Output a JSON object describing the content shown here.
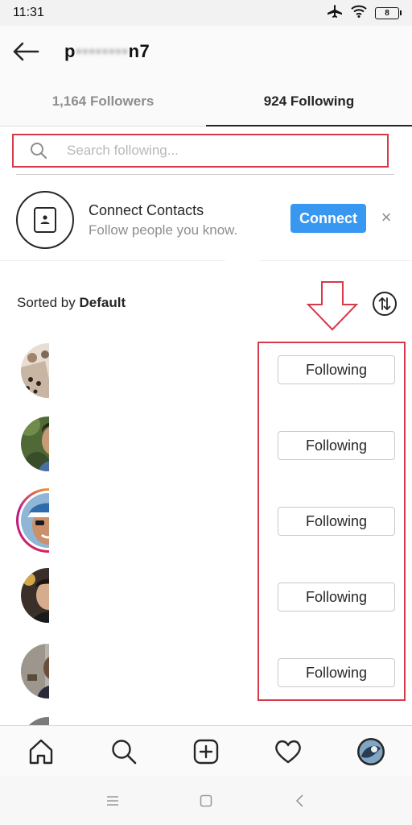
{
  "status": {
    "time": "11:31",
    "battery": "8"
  },
  "header": {
    "username_start": "p",
    "username_blur": "••••••••",
    "username_end": "n7"
  },
  "tabs": [
    {
      "label": "1,164 Followers",
      "active": false
    },
    {
      "label": "924 Following",
      "active": true
    }
  ],
  "search": {
    "placeholder": "Search following..."
  },
  "contacts": {
    "title": "Connect Contacts",
    "subtitle": "Follow people you know.",
    "connect_label": "Connect",
    "dismiss_label": "×"
  },
  "sort": {
    "prefix": "Sorted by",
    "value": "Default"
  },
  "rows": [
    {
      "button_label": "Following",
      "story_ring": false
    },
    {
      "button_label": "Following",
      "story_ring": false
    },
    {
      "button_label": "Following",
      "story_ring": true
    },
    {
      "button_label": "Following",
      "story_ring": false
    },
    {
      "button_label": "Following",
      "story_ring": false
    }
  ],
  "colors": {
    "accent": "#3897f0",
    "annotation": "#d63a4a"
  },
  "nav": [
    "home-icon",
    "search-icon",
    "add-post-icon",
    "activity-heart-icon",
    "profile-icon"
  ],
  "system_nav": [
    "menu-icon",
    "home-square-icon",
    "back-icon"
  ]
}
